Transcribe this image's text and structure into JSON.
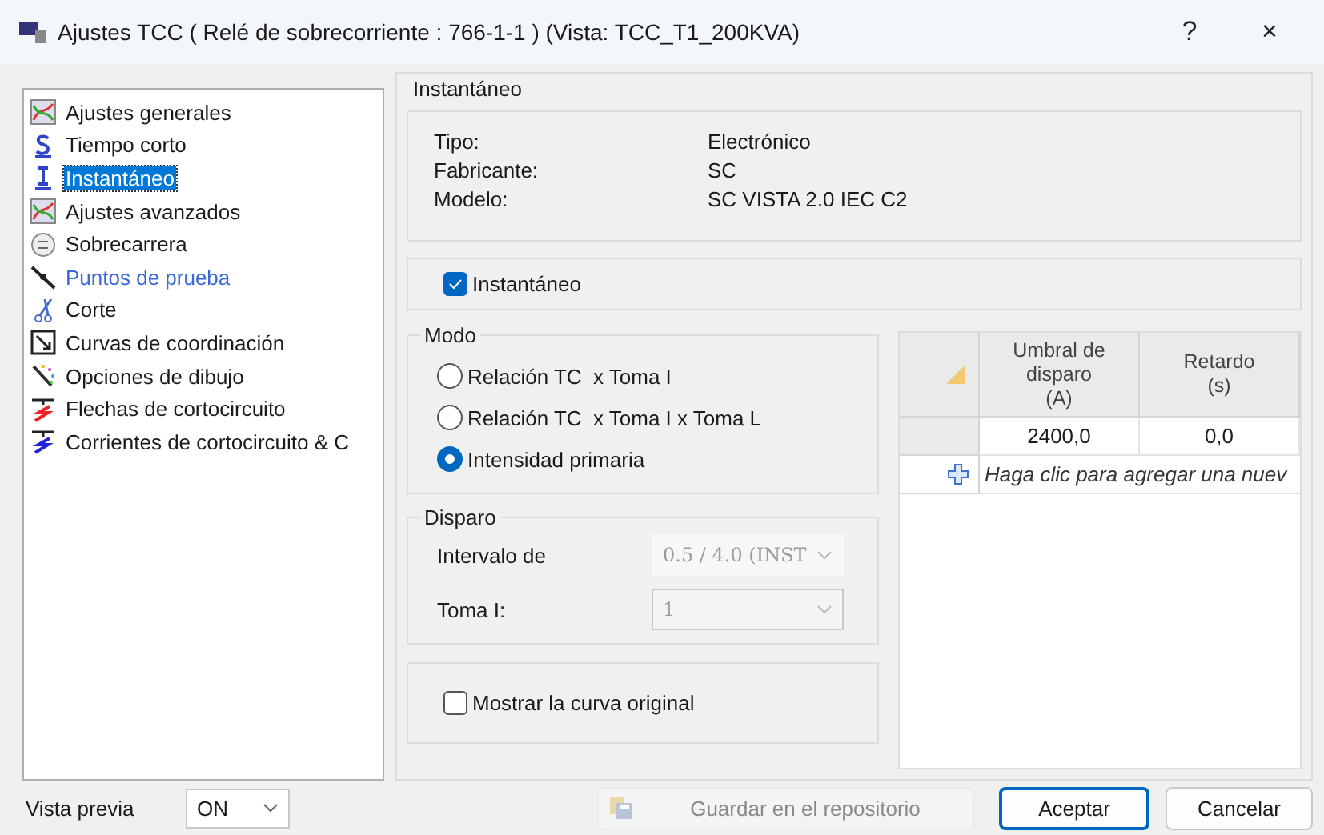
{
  "window": {
    "title": "Ajustes TCC ( Relé de sobrecorriente : 766-1-1 ) (Vista: TCC_T1_200KVA)",
    "help": "?",
    "close": "×"
  },
  "sidebar": {
    "items": [
      {
        "label": "Ajustes generales",
        "selected": false,
        "kind": "normal"
      },
      {
        "label": "Tiempo corto",
        "selected": false,
        "kind": "normal"
      },
      {
        "label": "Instantáneo",
        "selected": true,
        "kind": "normal"
      },
      {
        "label": "Ajustes avanzados",
        "selected": false,
        "kind": "normal"
      },
      {
        "label": "Sobrecarrera",
        "selected": false,
        "kind": "normal"
      },
      {
        "label": "Puntos de prueba",
        "selected": false,
        "kind": "link"
      },
      {
        "label": "Corte",
        "selected": false,
        "kind": "normal"
      },
      {
        "label": "Curvas de coordinación",
        "selected": false,
        "kind": "normal"
      },
      {
        "label": "Opciones de dibujo",
        "selected": false,
        "kind": "normal"
      },
      {
        "label": "Flechas de cortocircuito",
        "selected": false,
        "kind": "normal"
      },
      {
        "label": "Corrientes de cortocircuito & C",
        "selected": false,
        "kind": "normal"
      }
    ]
  },
  "panel": {
    "title": "Instantáneo",
    "info": [
      {
        "label": "Tipo:",
        "value": "Electrónico"
      },
      {
        "label": "Fabricante:",
        "value": "SC"
      },
      {
        "label": "Modelo:",
        "value": "SC VISTA 2.0 IEC C2"
      }
    ],
    "enable": {
      "label": "Instantáneo",
      "checked": true
    },
    "mode": {
      "title": "Modo",
      "options": [
        {
          "label": "Relación TC  x Toma I",
          "selected": false
        },
        {
          "label": "Relación TC  x Toma I x Toma L",
          "selected": false
        },
        {
          "label": "Intensidad primaria",
          "selected": true
        }
      ]
    },
    "trip": {
      "title": "Disparo",
      "fields": [
        {
          "label": "Intervalo de",
          "value": "0.5 / 4.0 (INST",
          "disabled": true,
          "kind": "flat"
        },
        {
          "label": "Toma I:",
          "value": "1",
          "disabled": true,
          "kind": "boxed"
        }
      ]
    },
    "show_original": {
      "label": "Mostrar la curva original",
      "checked": false
    },
    "table": {
      "columns": [
        "Umbral de\ndisparo\n(A)",
        "Retardo\n(s)"
      ],
      "rows": [
        [
          "2400,0",
          "0,0"
        ]
      ],
      "new_row": "Haga clic para agregar una nuev"
    }
  },
  "footer": {
    "preview_label": "Vista previa",
    "preview_value": "ON",
    "buttons": [
      {
        "label": "Guardar en el repositorio",
        "disabled": true,
        "default": false,
        "kind": "save"
      },
      {
        "label": "Aceptar",
        "disabled": false,
        "default": true,
        "kind": "plain"
      },
      {
        "label": "Cancelar",
        "disabled": false,
        "default": false,
        "kind": "plain"
      }
    ]
  }
}
